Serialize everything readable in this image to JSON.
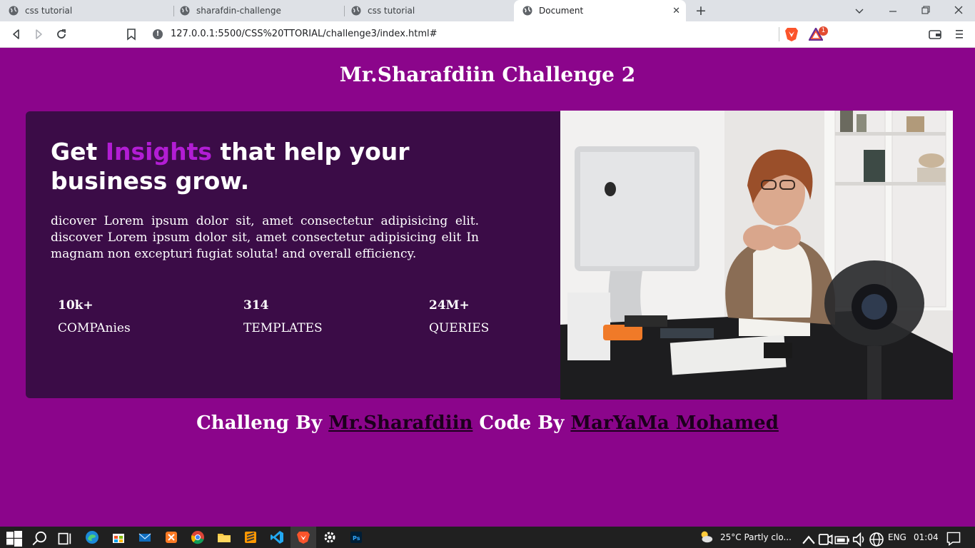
{
  "browser": {
    "tabs": [
      {
        "title": "css tutorial"
      },
      {
        "title": "sharafdin-challenge"
      },
      {
        "title": "css tutorial"
      },
      {
        "title": "Document"
      }
    ],
    "new_tab": "+",
    "close_tab": "✕",
    "address": "127.0.0.1:5500/CSS%20TTORIAL/challenge3/index.html#",
    "security_icon": "info-icon",
    "badge_count": "1"
  },
  "page": {
    "title": "Mr.Sharafdiin Challenge 2",
    "headline": {
      "before": "Get ",
      "accent": "Insights",
      "after": " that help your business grow."
    },
    "description": "dicover Lorem ipsum dolor sit, amet consectetur adipisicing elit. discover Lorem ipsum dolor sit, amet consectetur adipisicing elit In magnam non excepturi fugiat soluta! and overall efficiency.",
    "stats": [
      {
        "value": "10k+",
        "label": "COMPAnies"
      },
      {
        "value": "314",
        "label": "TEMPLATES"
      },
      {
        "value": "24M+",
        "label": "QUERIES"
      }
    ],
    "footer": {
      "prefix": "Challeng By ",
      "challenger": "Mr.Sharafdiin",
      "middle": " Code By ",
      "coder": "MarYaMa Mohamed"
    }
  },
  "colors": {
    "page_bg": "#8b058b",
    "card_bg": "#3b0c47",
    "accent": "#b21dd4"
  },
  "taskbar": {
    "weather": "25°C  Partly clo...",
    "language": "ENG",
    "time": "01:04"
  }
}
